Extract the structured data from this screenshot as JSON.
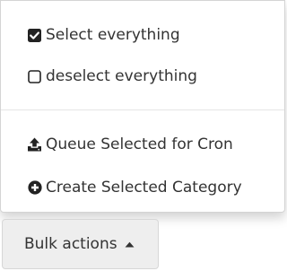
{
  "menu": {
    "items": [
      {
        "label": "Select everything",
        "icon": "checked-checkbox-icon"
      },
      {
        "label": "deselect everything",
        "icon": "empty-checkbox-icon"
      },
      {
        "label": "Queue Selected for Cron",
        "icon": "upload-icon"
      },
      {
        "label": "Create Selected Category",
        "icon": "plus-circle-icon"
      }
    ]
  },
  "button": {
    "label": "Bulk actions",
    "icon": "caret-up-icon"
  },
  "colors": {
    "text": "#333333",
    "button_bg": "#eeeeee",
    "border": "#d4d4d4"
  }
}
